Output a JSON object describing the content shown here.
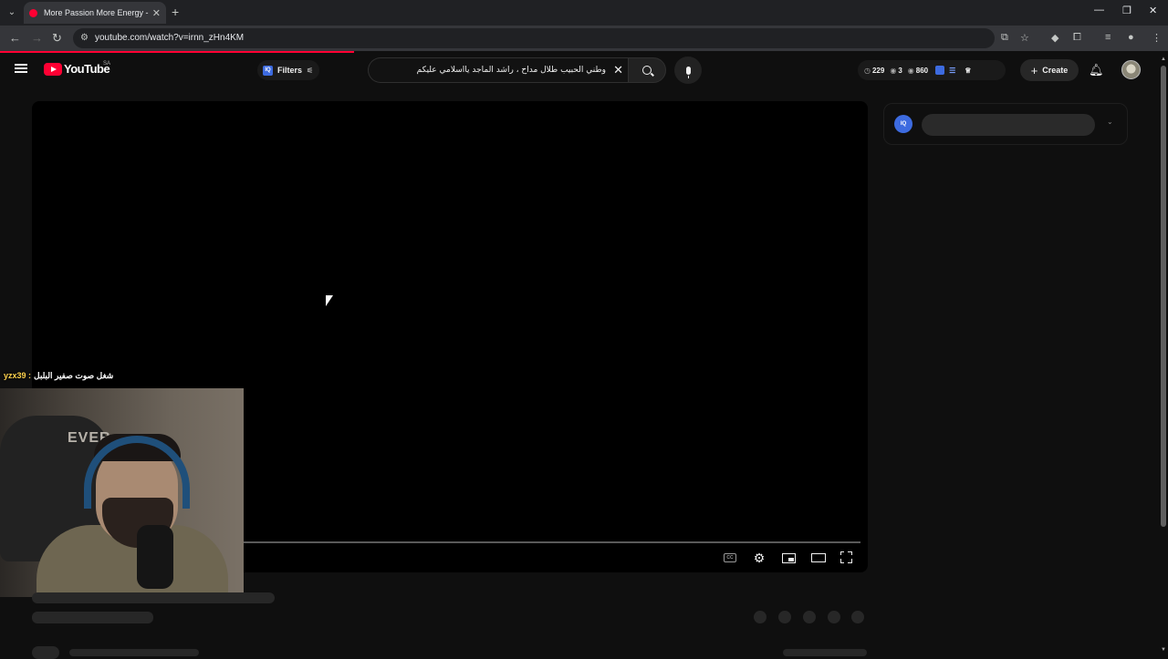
{
  "browser": {
    "tab_title": "More Passion More Energy - Yo",
    "new_tab_glyph": "+",
    "url": "youtube.com/watch?v=irnn_zHn4KM"
  },
  "youtube": {
    "logo_text": "YouTube",
    "region": "SA",
    "filters_label": "Filters",
    "search_query": "وطني الحبيب طلال مداح ، راشد الماجد يااسلامي عليكم",
    "stats": [
      {
        "icon": "clock-icon",
        "value": "229"
      },
      {
        "icon": "eye-icon",
        "value": "3"
      },
      {
        "icon": "eye-icon",
        "value": "860"
      }
    ],
    "create_label": "Create"
  },
  "stream_overlay": {
    "chat_user": "yzx39 :",
    "chat_message": "شغل صوت صفير البلبل",
    "webcam_brand": "EVER"
  },
  "side_panel": {
    "iq_label": "IQ"
  },
  "colors": {
    "accent": "#ff0033",
    "iq_blue": "#3d6be0",
    "background": "#0f0f0f"
  }
}
